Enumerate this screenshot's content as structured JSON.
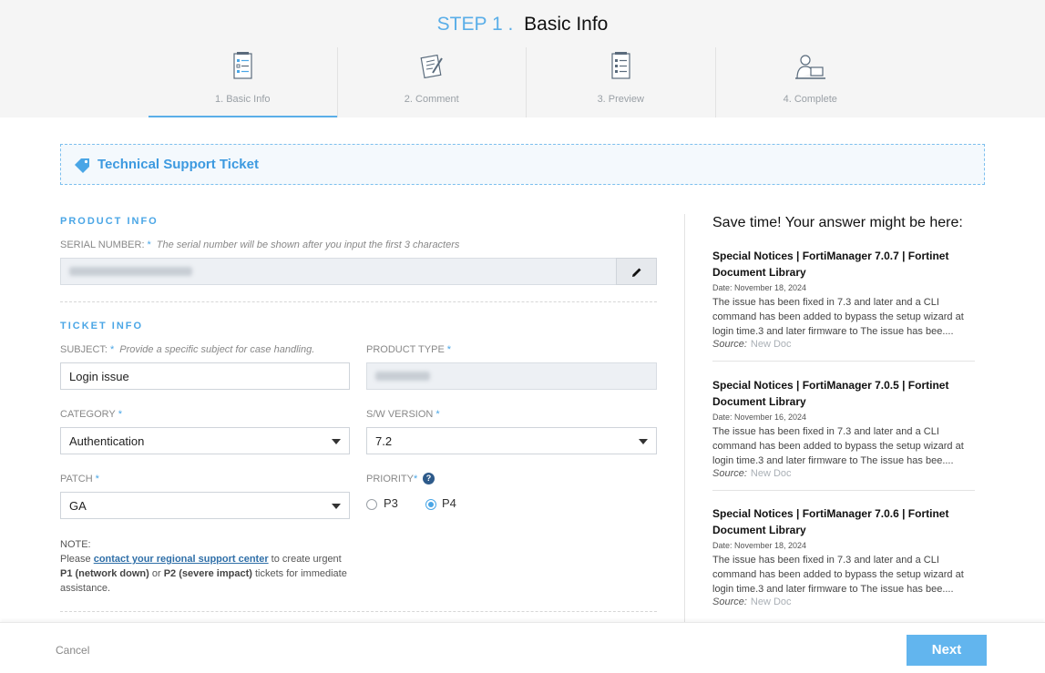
{
  "header": {
    "step_label": "STEP 1 .",
    "step_name": "Basic Info",
    "steps": [
      {
        "label": "1. Basic Info",
        "icon": "checklist-icon",
        "active": true
      },
      {
        "label": "2. Comment",
        "icon": "notepad-pen-icon",
        "active": false
      },
      {
        "label": "3. Preview",
        "icon": "document-list-icon",
        "active": false
      },
      {
        "label": "4. Complete",
        "icon": "person-laptop-icon",
        "active": false
      }
    ]
  },
  "banner": {
    "icon": "tag-icon",
    "title": "Technical Support Ticket"
  },
  "product_info": {
    "heading": "PRODUCT INFO",
    "serial_label": "SERIAL NUMBER:",
    "serial_hint": "The serial number will be shown after you input the first 3 characters"
  },
  "ticket_info": {
    "heading": "TICKET INFO",
    "subject_label": "SUBJECT:",
    "subject_hint": "Provide a specific subject for case handling.",
    "subject_value": "Login issue",
    "product_type_label": "PRODUCT TYPE",
    "category_label": "CATEGORY",
    "category_value": "Authentication",
    "sw_version_label": "S/W VERSION",
    "sw_version_value": "7.2",
    "patch_label": "PATCH",
    "patch_value": "GA",
    "priority_label": "PRIORITY",
    "priority_options": [
      "P3",
      "P4"
    ],
    "priority_selected": "P4",
    "required_mark": "*",
    "help_glyph": "?"
  },
  "note": {
    "label": "NOTE:",
    "prefix": "Please ",
    "link_text": "contact your regional support center",
    "mid1": " to create urgent ",
    "p1": "P1 (network down)",
    "mid2": " or ",
    "p2": "P2 (severe impact)",
    "suffix": " tickets for immediate assistance."
  },
  "suggestions": {
    "title": "Save time! Your answer might be here:",
    "source_label": "Source:",
    "articles": [
      {
        "title": "Special Notices | FortiManager 7.0.7 | Fortinet Document Library",
        "date": "Date: November 18, 2024",
        "desc": "The issue has been fixed in 7.3 and later and a CLI command has been added to bypass the setup wizard at login time.3 and later firmware to The issue has bee....",
        "source": "New Doc"
      },
      {
        "title": "Special Notices | FortiManager 7.0.5 | Fortinet Document Library",
        "date": "Date: November 16, 2024",
        "desc": "The issue has been fixed in 7.3 and later and a CLI command has been added to bypass the setup wizard at login time.3 and later firmware to The issue has bee....",
        "source": "New Doc"
      },
      {
        "title": "Special Notices | FortiManager 7.0.6 | Fortinet Document Library",
        "date": "Date: November 18, 2024",
        "desc": "The issue has been fixed in 7.3 and later and a CLI command has been added to bypass the setup wizard at login time.3 and later firmware to The issue has bee....",
        "source": "New Doc"
      }
    ]
  },
  "footer": {
    "cancel_label": "Cancel",
    "next_label": "Next"
  },
  "colors": {
    "accent": "#4aa6e6",
    "next_button": "#62b5ee",
    "banner_border": "#7cbfee"
  }
}
